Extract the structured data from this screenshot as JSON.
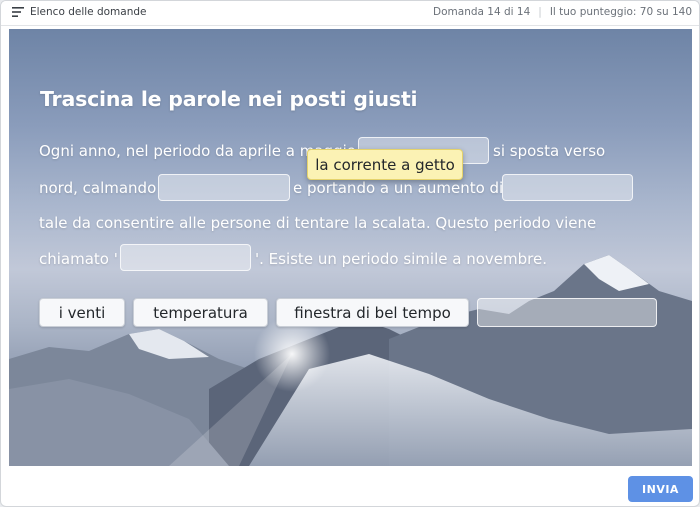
{
  "topbar": {
    "question_list_label": "Elenco delle domande",
    "question_counter": "Domanda 14 di 14",
    "score": "Il tuo punteggio: 70 su 140"
  },
  "exercise": {
    "title": "Trascina le parole nei posti giusti",
    "text": {
      "line1_a": "Ogni anno, nel periodo da aprile a maggio,",
      "line1_b": "si sposta verso",
      "line2_a": "nord, calmando",
      "line2_b": "e portando a un aumento di",
      "line3": "tale da consentire alle persone di tentare la scalata. Questo periodo viene",
      "line4_a": "chiamato '",
      "line4_b": "'. Esiste un periodo simile a novembre."
    },
    "dragging_chip": "la corrente a getto",
    "word_bank": [
      "i venti",
      "temperatura",
      "finestra di bel tempo",
      ""
    ]
  },
  "submit_label": "INVIA",
  "colors": {
    "submit": "#5e91e5",
    "drag_chip": "#fbf2b4"
  }
}
